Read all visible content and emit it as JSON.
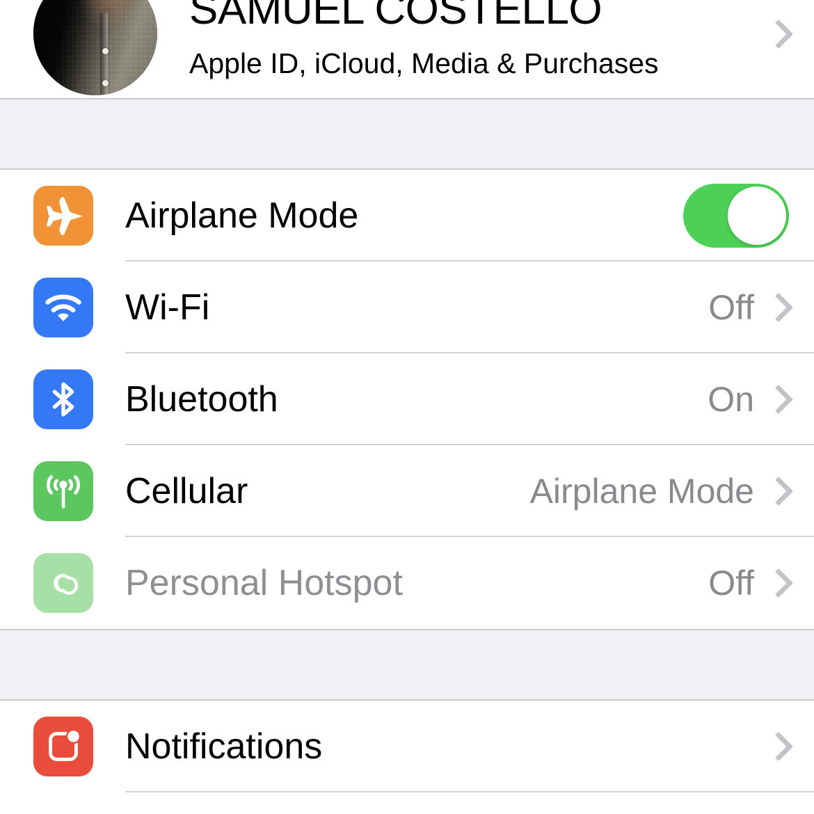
{
  "account": {
    "name": "SAMUEL COSTELLO",
    "subtitle": "Apple ID, iCloud, Media & Purchases",
    "avatar_icon": "user-photo-avatar",
    "chevron_icon": "chevron-right-icon"
  },
  "colors": {
    "page_background": "#ffffff",
    "section_gap": "#f0f0f5",
    "separator": "#d2d2d7",
    "toggle_on": "#4cd055",
    "value_text": "#8a8a8e",
    "disabled_text": "#8e8e93",
    "chevron": "#c2c2c7",
    "icon_airplane": "#f09235",
    "icon_wifi": "#3478f6",
    "icon_bluetooth": "#3478f6",
    "icon_cellular": "#5cc75f",
    "icon_hotspot": "#a6e0a6",
    "icon_notifications": "#ea4c3c"
  },
  "sections": [
    {
      "id": "connectivity",
      "rows": [
        {
          "id": "airplane-mode",
          "label": "Airplane Mode",
          "icon": "airplane-icon",
          "control": "toggle",
          "toggle_state": "on",
          "value": "",
          "disabled": false
        },
        {
          "id": "wifi",
          "label": "Wi-Fi",
          "icon": "wifi-icon",
          "control": "disclosure",
          "value": "Off",
          "disabled": false
        },
        {
          "id": "bluetooth",
          "label": "Bluetooth",
          "icon": "bluetooth-icon",
          "control": "disclosure",
          "value": "On",
          "disabled": false
        },
        {
          "id": "cellular",
          "label": "Cellular",
          "icon": "cellular-antenna-icon",
          "control": "disclosure",
          "value": "Airplane Mode",
          "disabled": false
        },
        {
          "id": "personal-hotspot",
          "label": "Personal Hotspot",
          "icon": "hotspot-link-icon",
          "control": "disclosure",
          "value": "Off",
          "disabled": true
        }
      ]
    },
    {
      "id": "notifications-group",
      "rows": [
        {
          "id": "notifications",
          "label": "Notifications",
          "icon": "notifications-badge-icon",
          "control": "disclosure",
          "value": "",
          "disabled": false
        }
      ]
    }
  ]
}
